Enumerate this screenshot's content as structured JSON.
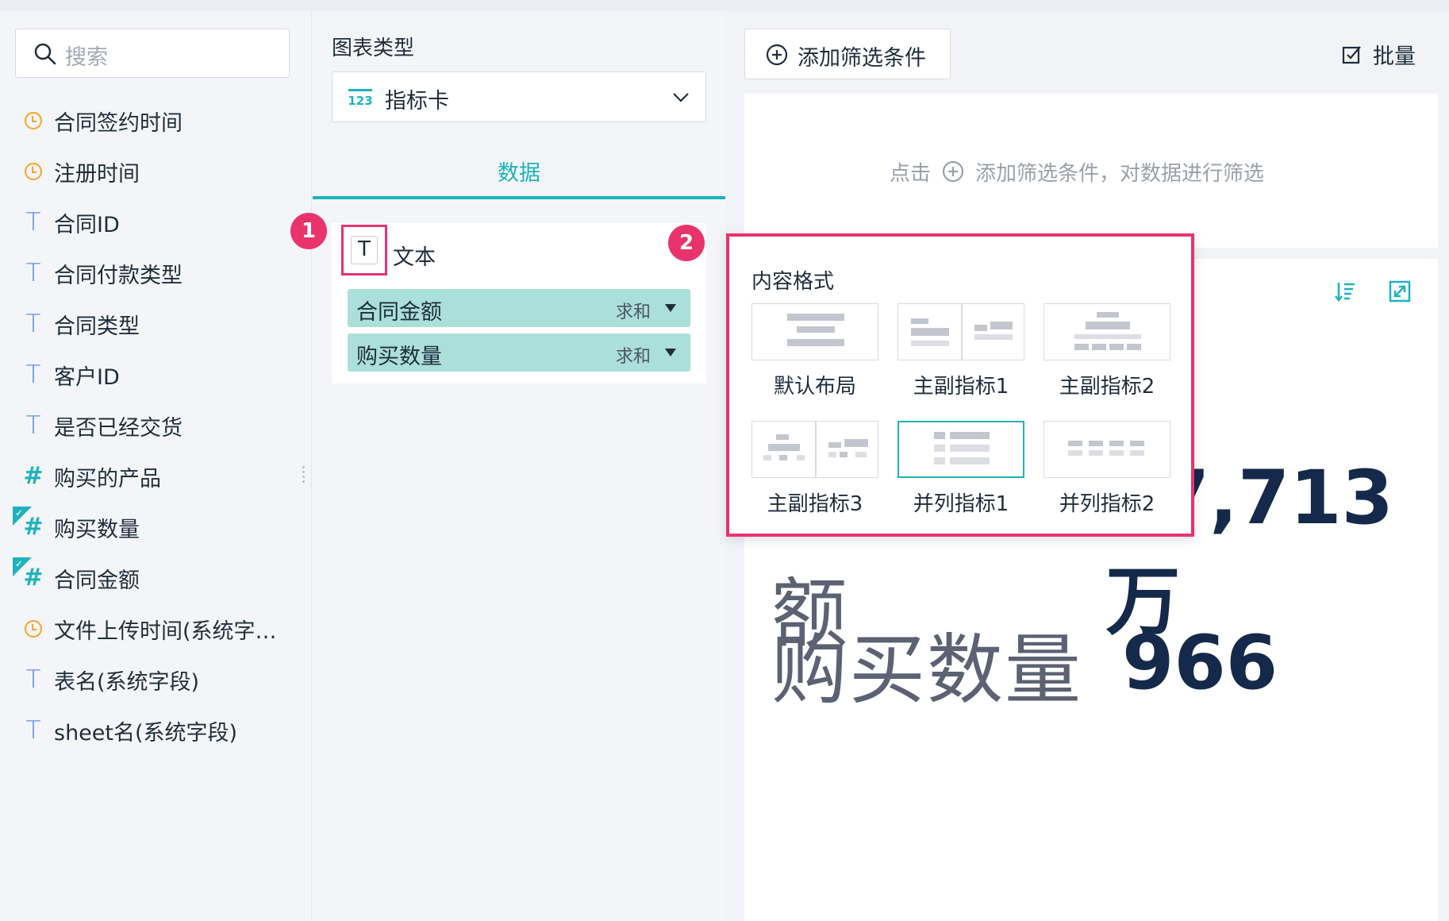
{
  "left": {
    "search_placeholder": "搜索",
    "fields": [
      {
        "type": "clock-icon",
        "label": "合同签约时间"
      },
      {
        "type": "text-icon",
        "label": "合同ID"
      },
      {
        "type": "text-icon",
        "label": "合同付款类型"
      },
      {
        "type": "text-icon",
        "label": "合同类型"
      },
      {
        "type": "text-icon",
        "label": "客户ID"
      },
      {
        "type": "text-icon",
        "label": "是否已经交货"
      },
      {
        "type": "number-icon",
        "label": "购买的产品"
      },
      {
        "type": "number-icon",
        "label": "购买数量",
        "checked": true
      },
      {
        "type": "number-icon",
        "label": "合同金额",
        "checked": true
      },
      {
        "type": "clock-icon",
        "label": "文件上传时间(系统字…"
      },
      {
        "type": "text-icon",
        "label": "表名(系统字段)"
      },
      {
        "type": "text-icon",
        "label": "sheet名(系统字段)"
      },
      {
        "type": "clock-icon",
        "label": "注册时间"
      }
    ]
  },
  "middle": {
    "chart_type_label": "图表类型",
    "chart_type_value": "指标卡",
    "chart_type_badge": "123",
    "tab_data": "数据",
    "text_label": "文本",
    "text_icon_glyph": "T",
    "measures": [
      {
        "name": "合同金额",
        "agg": "求和"
      },
      {
        "name": "购买数量",
        "agg": "求和"
      }
    ],
    "badge1": "1",
    "badge2": "2"
  },
  "right": {
    "add_filter_label": "添加筛选条件",
    "batch_label": "批量",
    "hint_prefix": "点击",
    "hint_suffix": "添加筛选条件，对数据进行筛选",
    "metrics": [
      {
        "name": "合同金额",
        "value": "87,713万"
      },
      {
        "name": "购买数量",
        "value": "966"
      }
    ]
  },
  "popup": {
    "title": "内容格式",
    "options": [
      {
        "label": "默认布局",
        "selected": false
      },
      {
        "label": "主副指标1",
        "selected": false
      },
      {
        "label": "主副指标2",
        "selected": false
      },
      {
        "label": "主副指标3",
        "selected": false
      },
      {
        "label": "并列指标1",
        "selected": true
      },
      {
        "label": "并列指标2",
        "selected": false
      }
    ]
  },
  "colors": {
    "accent": "#1fb2bd",
    "highlight": "#e8336d",
    "clock": "#f5a623",
    "text_icon": "#5b8ff9"
  }
}
